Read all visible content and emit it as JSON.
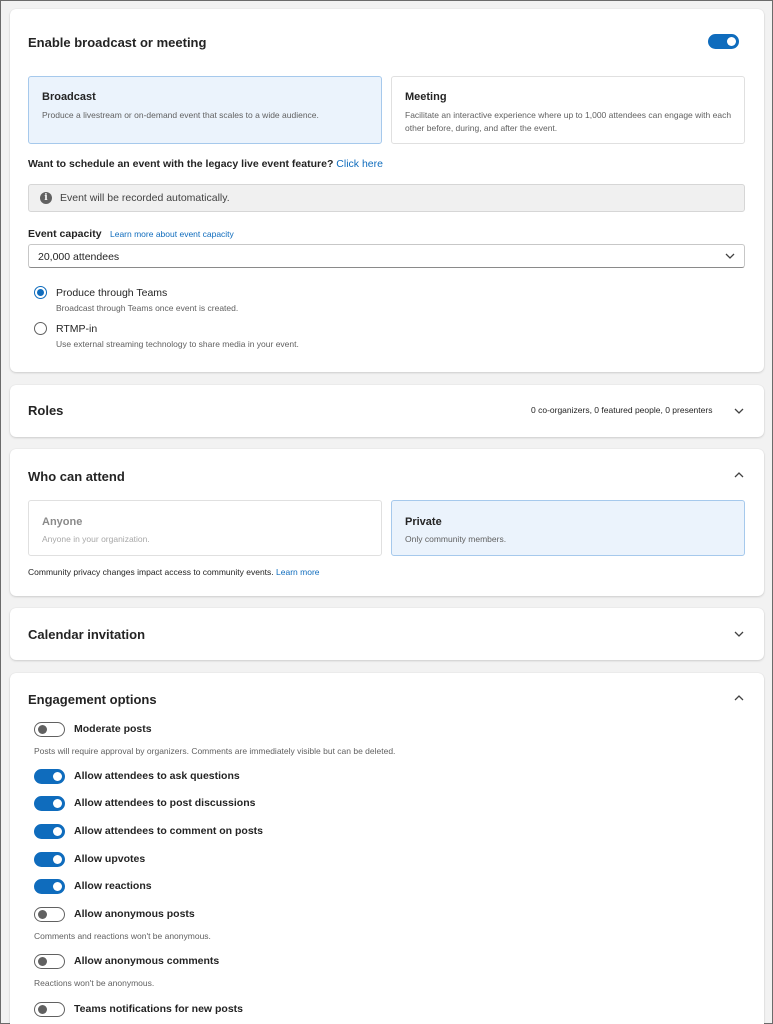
{
  "broadcast_card": {
    "title": "Enable broadcast or meeting",
    "toggle_on": true,
    "options": [
      {
        "title": "Broadcast",
        "description": "Produce a livestream or on-demand event that scales to a wide audience.",
        "selected": true
      },
      {
        "title": "Meeting",
        "description": "Facilitate an interactive experience where up to 1,000 attendees can engage with each other before, during, and after the event.",
        "selected": false
      }
    ],
    "legacy_prompt": "Want to schedule an event with the legacy live event feature?",
    "legacy_link": "Click here",
    "info_icon": "info-icon",
    "info_text": "Event will be recorded automatically.",
    "capacity_label": "Event capacity",
    "capacity_link": "Learn more about event capacity",
    "capacity_value": "20,000 attendees",
    "produce_options": [
      {
        "label": "Produce through Teams",
        "description": "Broadcast through Teams once event is created.",
        "checked": true
      },
      {
        "label": "RTMP-in",
        "description": "Use external streaming technology to share media in your event.",
        "checked": false
      }
    ]
  },
  "roles_card": {
    "title": "Roles",
    "summary": "0 co-organizers, 0 featured people, 0 presenters"
  },
  "who_card": {
    "title": "Who can attend",
    "options": [
      {
        "title": "Anyone",
        "description": "Anyone in your organization.",
        "selected": false,
        "disabled": true
      },
      {
        "title": "Private",
        "description": "Only community members.",
        "selected": true,
        "disabled": false
      }
    ],
    "note": "Community privacy changes impact access to community events.",
    "note_link": "Learn more"
  },
  "calendar_card": {
    "title": "Calendar invitation"
  },
  "engagement_card": {
    "title": "Engagement options",
    "options": [
      {
        "label": "Moderate posts",
        "on": false,
        "description": "Posts will require approval by organizers. Comments are immediately visible but can be deleted."
      },
      {
        "label": "Allow attendees to ask questions",
        "on": true
      },
      {
        "label": "Allow attendees to post discussions",
        "on": true
      },
      {
        "label": "Allow attendees to comment on posts",
        "on": true
      },
      {
        "label": "Allow upvotes",
        "on": true
      },
      {
        "label": "Allow reactions",
        "on": true
      },
      {
        "label": "Allow anonymous posts",
        "on": false,
        "description": "Comments and reactions won't be anonymous."
      },
      {
        "label": "Allow anonymous comments",
        "on": false,
        "description": "Reactions won't be anonymous."
      },
      {
        "label": "Teams notifications for new posts",
        "on": false
      }
    ]
  },
  "colors": {
    "accent": "#0f6cbd",
    "selected_tile_bg": "#ebf3fc",
    "page_bg": "#f2f2f2"
  }
}
